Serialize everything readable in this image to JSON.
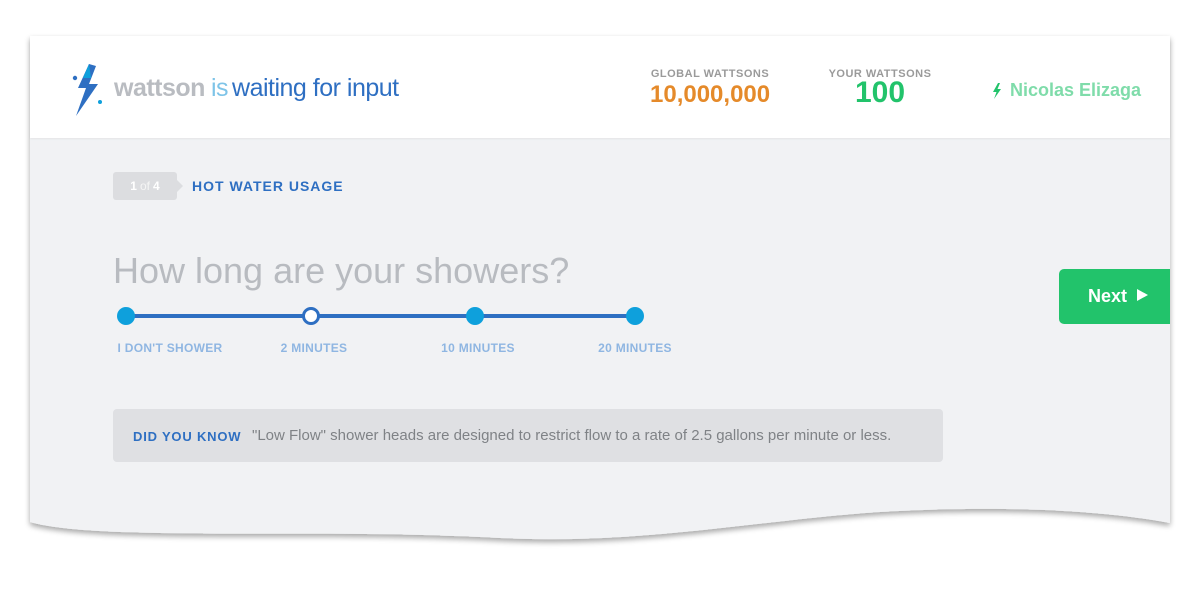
{
  "brand": {
    "name": "wattson",
    "connector": "is",
    "status": "waiting for input"
  },
  "stats": {
    "global": {
      "label": "GLOBAL WATTSONS",
      "value": "10,000,000"
    },
    "yours": {
      "label": "YOUR WATTSONS",
      "value": "100"
    }
  },
  "user": {
    "name": "Nicolas Elizaga"
  },
  "step": {
    "current": "1",
    "of": "of",
    "total": "4",
    "title": "HOT WATER USAGE"
  },
  "question": "How long are your showers?",
  "slider": {
    "options": [
      "I DON'T SHOWER",
      "2 MINUTES",
      "10 MINUTES",
      "20 MINUTES"
    ],
    "selected_index": 1
  },
  "next_button": {
    "label": "Next"
  },
  "tip": {
    "label": "DID YOU KNOW",
    "text": "\"Low Flow\" shower heads are designed to restrict flow to a rate of 2.5 gallons per minute or less."
  },
  "colors": {
    "accent_blue": "#2e6fc2",
    "light_blue": "#0ea0dc",
    "orange": "#e58a2a",
    "green": "#22c36b",
    "background": "#f1f2f4"
  },
  "icons": {
    "logo": "lightning-bolt-icon",
    "user": "lightning-bolt-icon",
    "next": "play-arrow-icon"
  }
}
